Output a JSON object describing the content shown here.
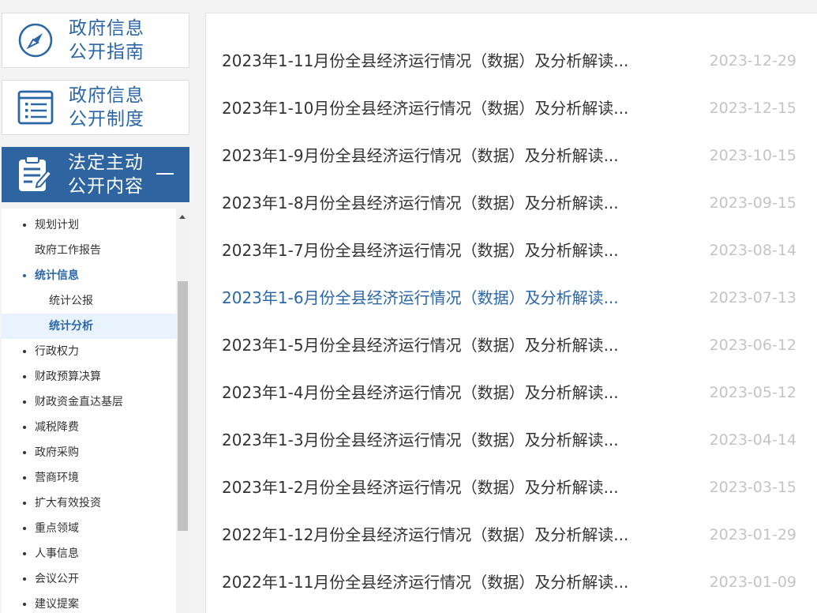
{
  "sidebar": {
    "cards": [
      {
        "line1": "政府信息",
        "line2": "公开指南",
        "icon": "compass-icon"
      },
      {
        "line1": "政府信息",
        "line2": "公开制度",
        "icon": "document-list-icon"
      }
    ],
    "active_card": {
      "line1": "法定主动",
      "line2": "公开内容",
      "icon": "clipboard-edit-icon",
      "toggle": "collapse"
    },
    "menu": [
      {
        "label": "规划计划",
        "level": 1,
        "bullet": true
      },
      {
        "label": "政府工作报告",
        "level": 1,
        "bullet": false
      },
      {
        "label": "统计信息",
        "level": 1,
        "bullet": true,
        "expanded": true
      },
      {
        "label": "统计公报",
        "level": 2
      },
      {
        "label": "统计分析",
        "level": 2,
        "selected": true
      },
      {
        "label": "行政权力",
        "level": 1,
        "bullet": true
      },
      {
        "label": "财政预算决算",
        "level": 1,
        "bullet": true
      },
      {
        "label": "财政资金直达基层",
        "level": 1,
        "bullet": true
      },
      {
        "label": "减税降费",
        "level": 1,
        "bullet": true
      },
      {
        "label": "政府采购",
        "level": 1,
        "bullet": true
      },
      {
        "label": "营商环境",
        "level": 1,
        "bullet": true
      },
      {
        "label": "扩大有效投资",
        "level": 1,
        "bullet": true
      },
      {
        "label": "重点领域",
        "level": 1,
        "bullet": true
      },
      {
        "label": "人事信息",
        "level": 1,
        "bullet": true
      },
      {
        "label": "会议公开",
        "level": 1,
        "bullet": true
      },
      {
        "label": "建议提案",
        "level": 1,
        "bullet": true
      }
    ]
  },
  "articles": [
    {
      "title": "2023年1-11月份全县经济运行情况（数据）及分析解读...",
      "date": "2023-12-29"
    },
    {
      "title": "2023年1-10月份全县经济运行情况（数据）及分析解读...",
      "date": "2023-12-15"
    },
    {
      "title": "2023年1-9月份全县经济运行情况（数据）及分析解读...",
      "date": "2023-10-15"
    },
    {
      "title": "2023年1-8月份全县经济运行情况（数据）及分析解读...",
      "date": "2023-09-15"
    },
    {
      "title": "2023年1-7月份全县经济运行情况（数据）及分析解读...",
      "date": "2023-08-14"
    },
    {
      "title": "2023年1-6月份全县经济运行情况（数据）及分析解读...",
      "date": "2023-07-13",
      "hovered": true
    },
    {
      "title": "2023年1-5月份全县经济运行情况（数据）及分析解读...",
      "date": "2023-06-12"
    },
    {
      "title": "2023年1-4月份全县经济运行情况（数据）及分析解读...",
      "date": "2023-05-12"
    },
    {
      "title": "2023年1-3月份全县经济运行情况（数据）及分析解读...",
      "date": "2023-04-14"
    },
    {
      "title": "2023年1-2月份全县经济运行情况（数据）及分析解读...",
      "date": "2023-03-15"
    },
    {
      "title": "2022年1-12月份全县经济运行情况（数据）及分析解读...",
      "date": "2023-01-29"
    },
    {
      "title": "2022年1-11月份全县经济运行情况（数据）及分析解读...",
      "date": "2023-01-09"
    }
  ],
  "colors": {
    "accent": "#2b66a6",
    "active_card_bg": "#2e64a0",
    "selected_bg": "#e8f3fd",
    "text": "#333333",
    "date": "#c4c4c4",
    "page_bg": "#f3f3f3"
  }
}
